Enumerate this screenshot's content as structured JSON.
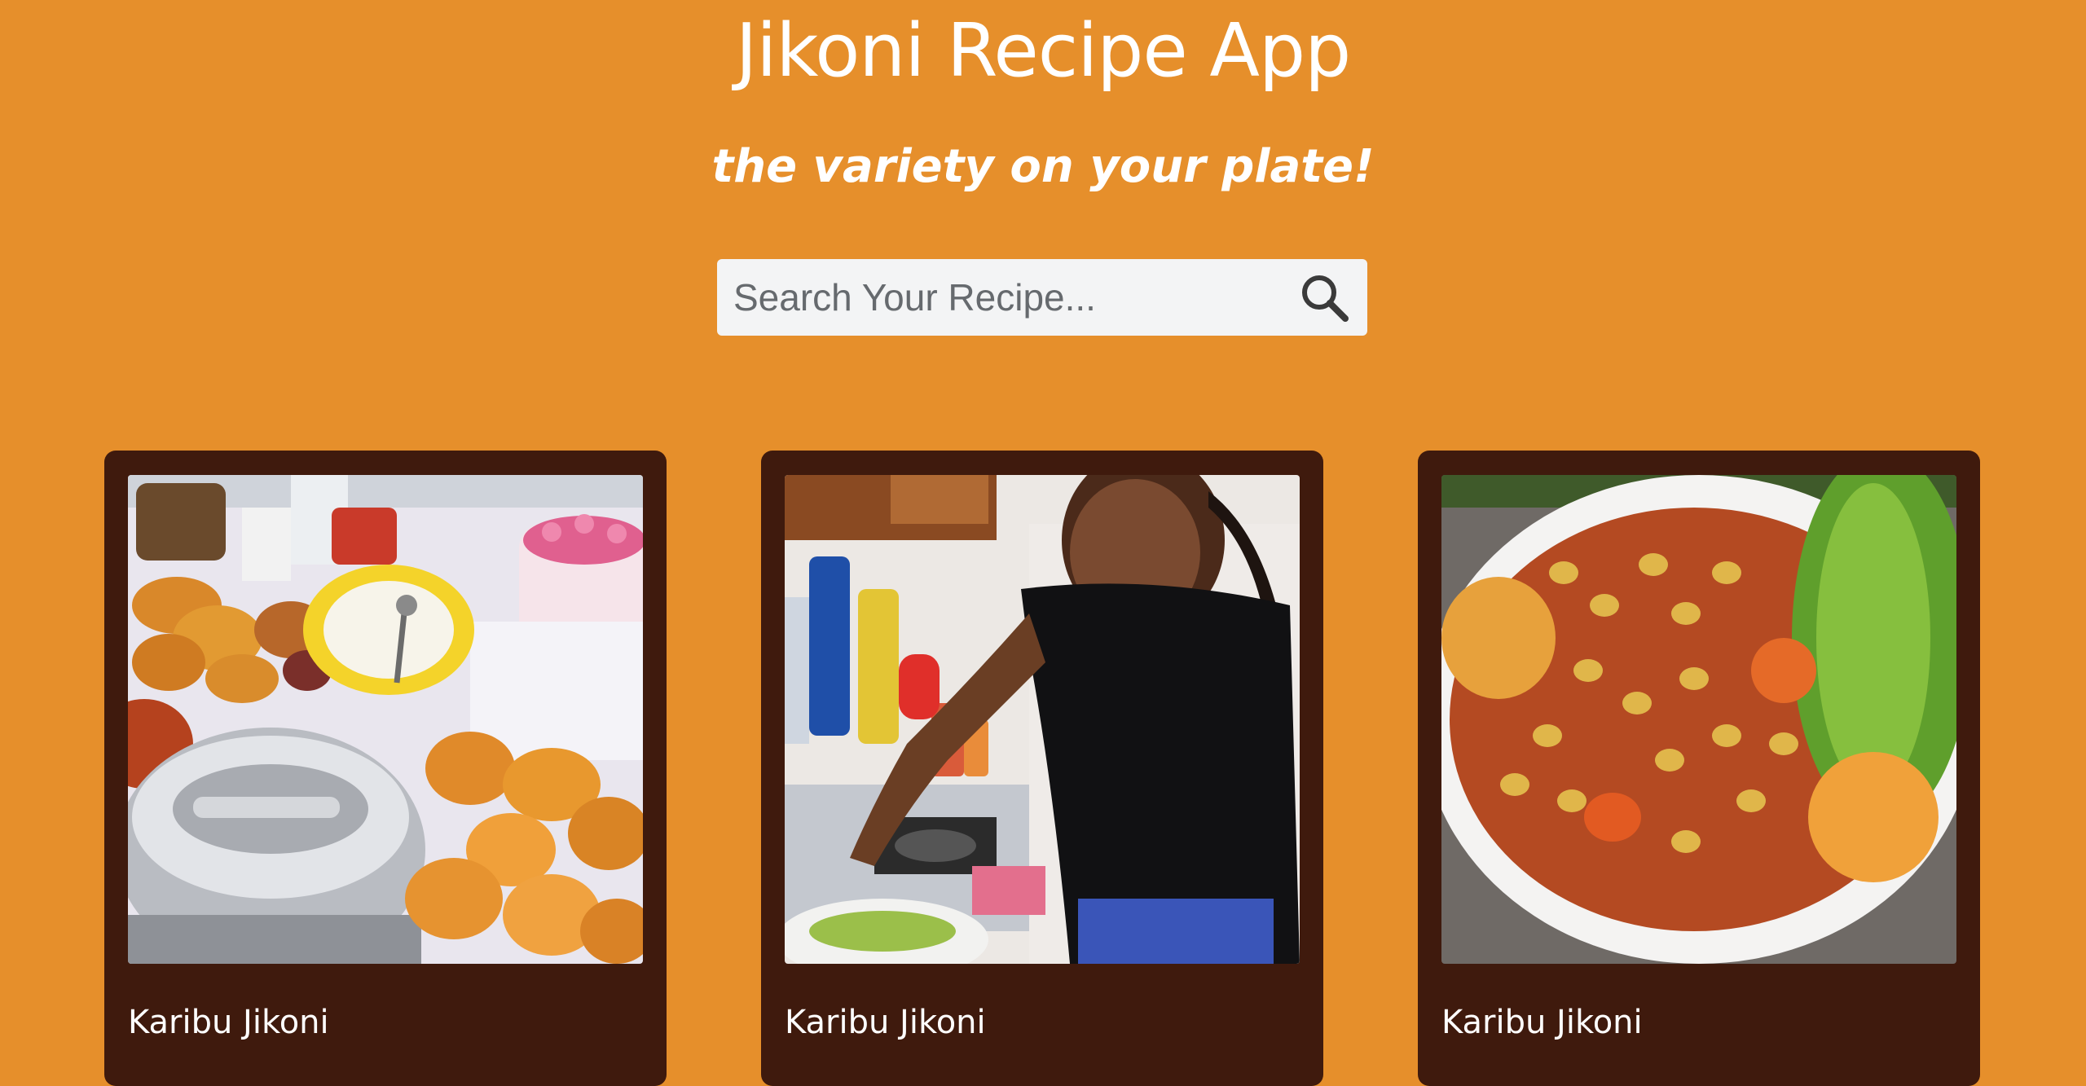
{
  "header": {
    "title": "Jikoni Recipe App",
    "subtitle": "the variety on your plate!"
  },
  "search": {
    "placeholder": "Search Your Recipe...",
    "value": "",
    "icon": "search-icon"
  },
  "cards": [
    {
      "caption": "Karibu Jikoni",
      "image": "food-spread-photo"
    },
    {
      "caption": "Karibu Jikoni",
      "image": "woman-cooking-photo"
    },
    {
      "caption": "Karibu Jikoni",
      "image": "beans-stew-photo"
    }
  ],
  "colors": {
    "background": "#e68f2b",
    "card": "#3f1a0d",
    "search_box": "#f3f4f5",
    "text": "#ffffff"
  }
}
